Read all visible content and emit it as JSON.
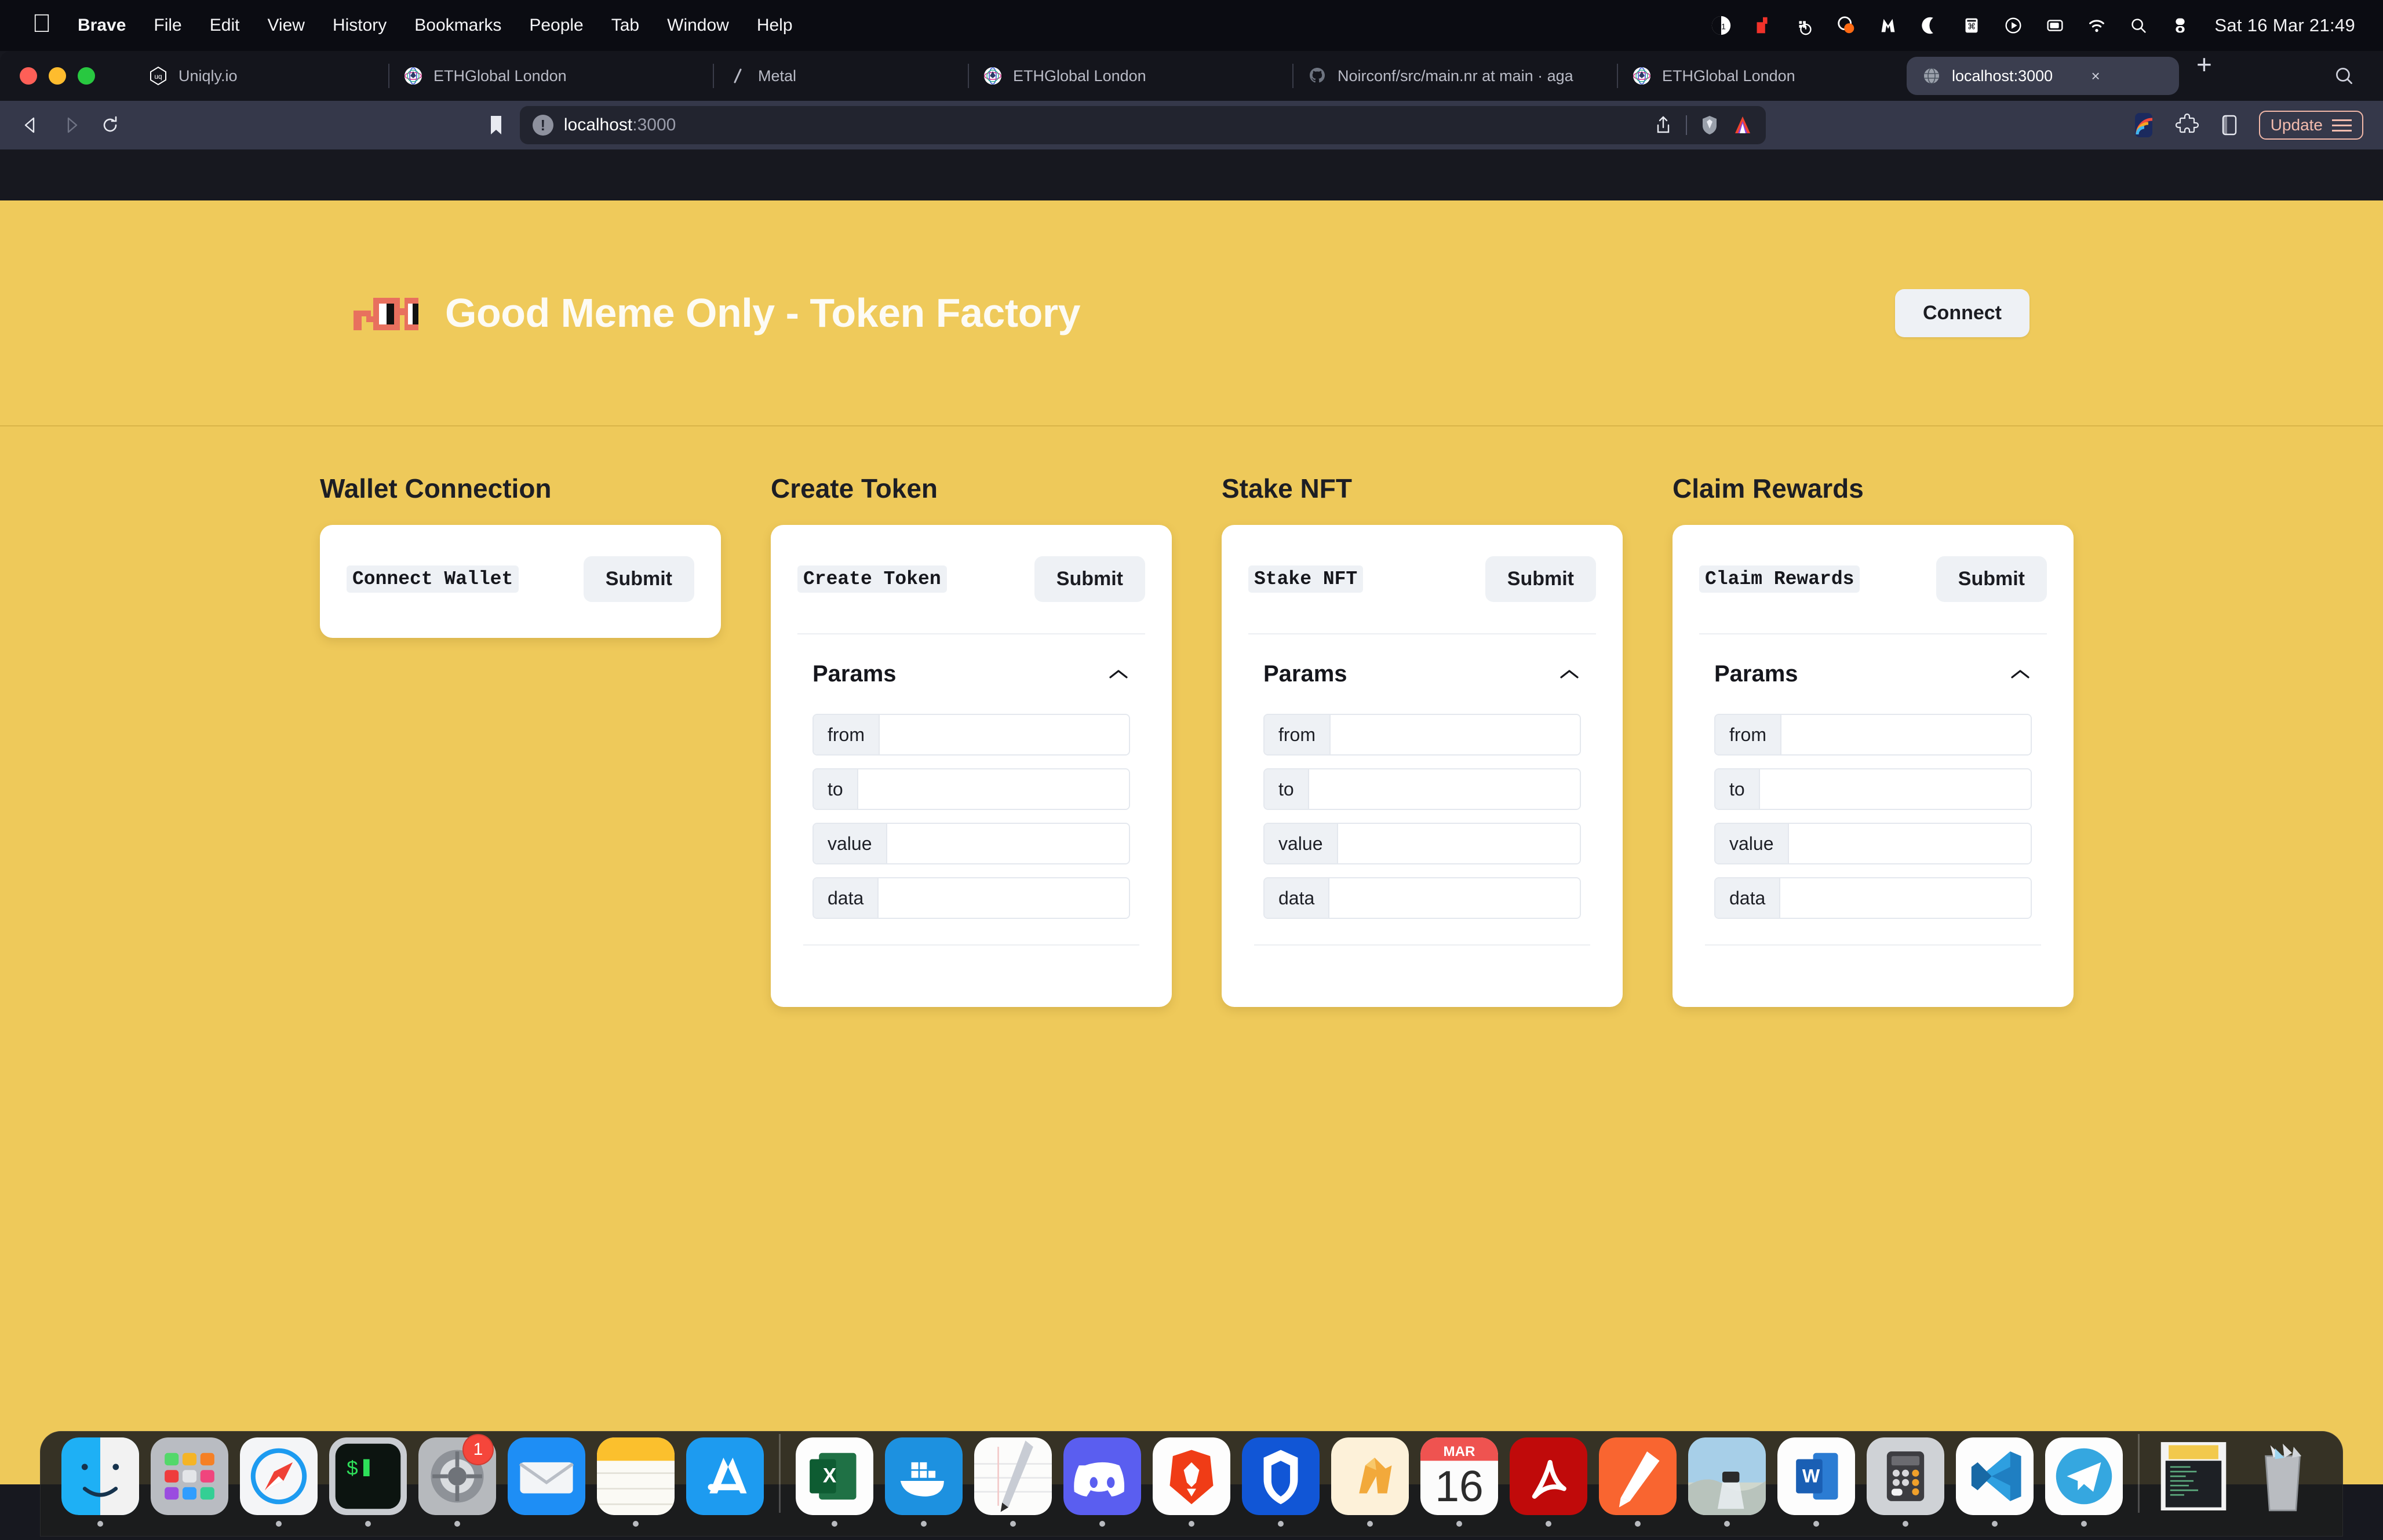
{
  "menubar": {
    "apple_glyph": "&#63743;",
    "items": [
      "Brave",
      "File",
      "Edit",
      "View",
      "History",
      "Bookmarks",
      "People",
      "Tab",
      "Window",
      "Help"
    ],
    "status_icons": [
      "calendar-31-icon",
      "todo-red-icon",
      "docker-icon",
      "monitor-control-icon",
      "malwarebytes-icon",
      "night-shift-moon-icon",
      "shortcuts-icon",
      "play-circle-icon",
      "screen-mirroring-icon",
      "wifi-icon",
      "spotlight-search-icon",
      "control-center-icon"
    ],
    "clock": "Sat 16 Mar  21:49"
  },
  "browser": {
    "tabs": [
      {
        "label": "Uniqly.io",
        "favicon": "uniqly-icon",
        "active": false
      },
      {
        "label": "ETHGlobal London",
        "favicon": "ethglobal-icon",
        "active": false
      },
      {
        "label": "Metal",
        "favicon": "metal-slash-icon",
        "active": false
      },
      {
        "label": "ETHGlobal London",
        "favicon": "ethglobal-icon",
        "active": false
      },
      {
        "label": "Noirconf/src/main.nr at main · aga",
        "favicon": "github-icon",
        "active": false
      },
      {
        "label": "ETHGlobal London",
        "favicon": "ethglobal-icon",
        "active": false
      },
      {
        "label": "localhost:3000",
        "favicon": "globe-icon",
        "active": true
      }
    ],
    "tab_close_label": "×",
    "new_tab_label": "+",
    "tab_search_icon": "search-icon",
    "nav": {
      "back_icon": "back-arrow-icon",
      "forward_icon": "forward-arrow-icon",
      "reload_icon": "reload-icon",
      "bookmark_icon": "bookmark-icon"
    },
    "omnibox": {
      "info_glyph": "!",
      "url_host": "localhost",
      "url_port": ":3000",
      "share_icon": "share-icon",
      "shields_icon": "brave-shields-icon",
      "leo_icon": "leo-ai-icon"
    },
    "toolbar_right": {
      "rainbow_icon": "rainbow-wallet-icon",
      "extensions_icon": "extensions-puzzle-icon",
      "sidebar_icon": "sidebar-toggle-icon",
      "update_label": "Update",
      "menu_icon": "hamburger-menu-icon"
    }
  },
  "site": {
    "logo_icon": "pixel-glasses-logo",
    "title": "Good Meme Only - Token Factory",
    "connect_label": "Connect",
    "colors": {
      "header_bg": "#efca5b",
      "page_bg": "#eec95a",
      "card_bg": "#ffffff",
      "button_bg": "#eef1f5",
      "text_dark": "#15161c",
      "logo_accent": "#e8705e"
    }
  },
  "sections": [
    {
      "title": "Wallet Connection",
      "function_name": "Connect Wallet",
      "submit_label": "Submit",
      "has_params": false,
      "params_label": "Params",
      "collapse_icon": "chevron-up-icon",
      "fields": []
    },
    {
      "title": "Create Token",
      "function_name": "Create Token",
      "submit_label": "Submit",
      "has_params": true,
      "params_label": "Params",
      "collapse_icon": "chevron-up-icon",
      "fields": [
        {
          "label": "from",
          "value": ""
        },
        {
          "label": "to",
          "value": ""
        },
        {
          "label": "value",
          "value": ""
        },
        {
          "label": "data",
          "value": ""
        }
      ]
    },
    {
      "title": "Stake NFT",
      "function_name": "Stake NFT",
      "submit_label": "Submit",
      "has_params": true,
      "params_label": "Params",
      "collapse_icon": "chevron-up-icon",
      "fields": [
        {
          "label": "from",
          "value": ""
        },
        {
          "label": "to",
          "value": ""
        },
        {
          "label": "value",
          "value": ""
        },
        {
          "label": "data",
          "value": ""
        }
      ]
    },
    {
      "title": "Claim Rewards",
      "function_name": "Claim Rewards",
      "submit_label": "Submit",
      "has_params": true,
      "params_label": "Params",
      "collapse_icon": "chevron-up-icon",
      "fields": [
        {
          "label": "from",
          "value": ""
        },
        {
          "label": "to",
          "value": ""
        },
        {
          "label": "value",
          "value": ""
        },
        {
          "label": "data",
          "value": ""
        }
      ]
    }
  ],
  "dock": {
    "items": [
      {
        "name": "finder",
        "running": true
      },
      {
        "name": "launchpad",
        "running": false
      },
      {
        "name": "safari",
        "running": true
      },
      {
        "name": "terminal",
        "running": true
      },
      {
        "name": "system-settings",
        "running": true,
        "badge": "1"
      },
      {
        "name": "mail",
        "running": false
      },
      {
        "name": "notes",
        "running": true
      },
      {
        "name": "app-store",
        "running": false
      },
      {
        "name": "excel",
        "running": true,
        "sep_before": true
      },
      {
        "name": "docker",
        "running": true
      },
      {
        "name": "notability",
        "running": true
      },
      {
        "name": "discord",
        "running": true
      },
      {
        "name": "brave",
        "running": true
      },
      {
        "name": "nordvpn",
        "running": true
      },
      {
        "name": "unity",
        "running": true
      },
      {
        "name": "calendar",
        "running": true,
        "cal_month": "MAR",
        "cal_day": "16"
      },
      {
        "name": "adobe-acrobat",
        "running": true
      },
      {
        "name": "preview-markup",
        "running": true
      },
      {
        "name": "photos-lightroom",
        "running": true
      },
      {
        "name": "microsoft-word",
        "running": true
      },
      {
        "name": "calculator",
        "running": true
      },
      {
        "name": "vs-code",
        "running": true
      },
      {
        "name": "telegram",
        "running": true
      },
      {
        "name": "stickies-file",
        "running": false,
        "sep_before": true
      },
      {
        "name": "trash",
        "running": false
      }
    ]
  }
}
